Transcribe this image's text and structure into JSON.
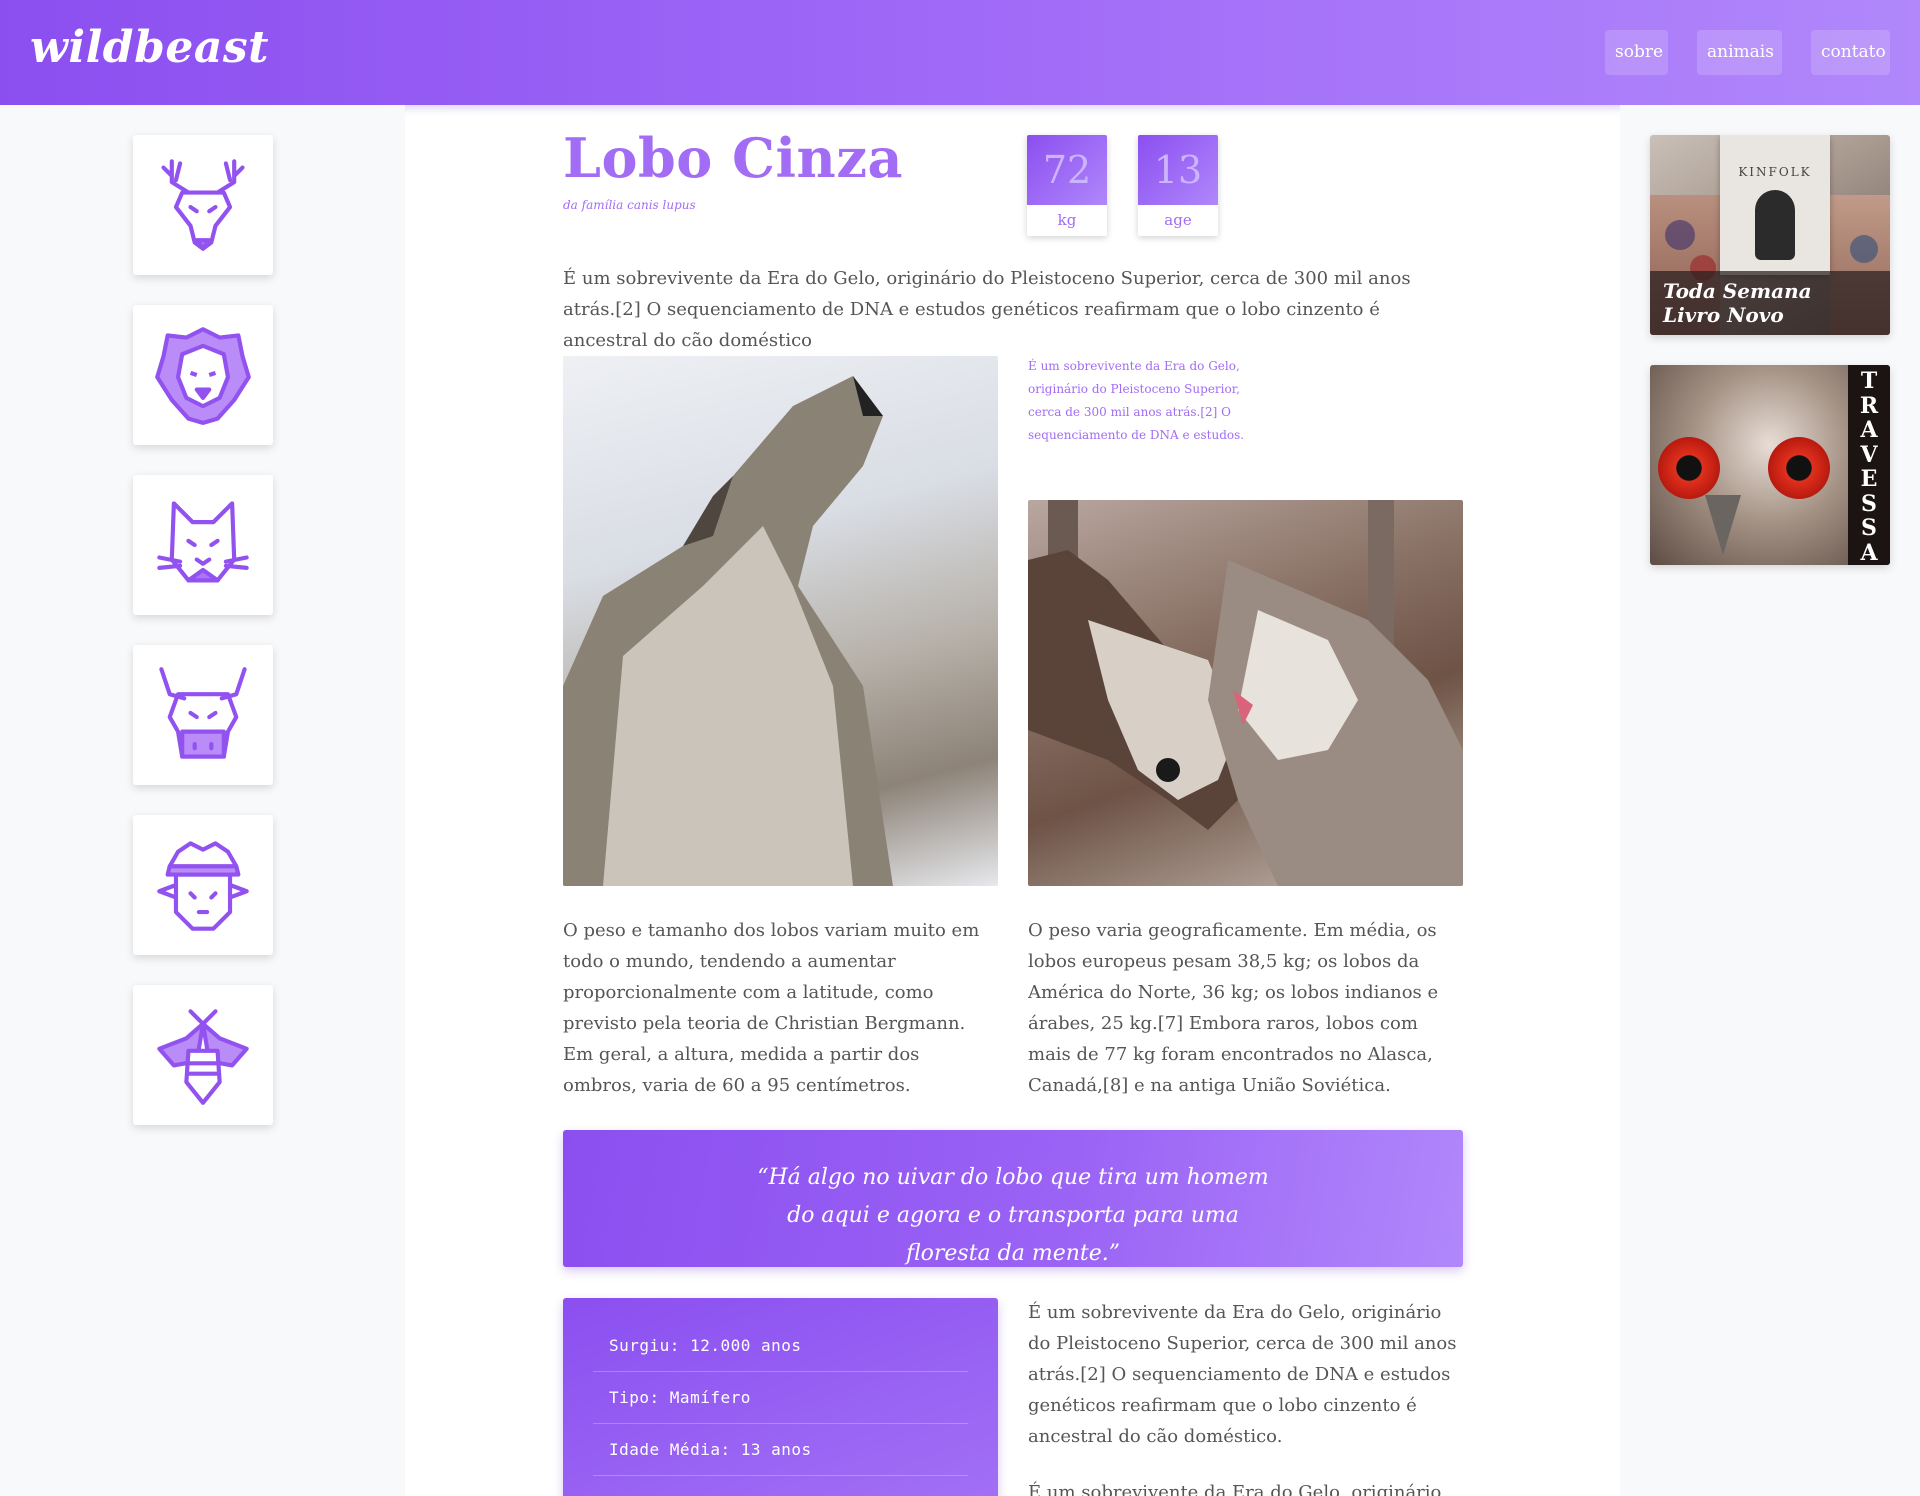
{
  "header": {
    "logo": "wildbeast",
    "nav": [
      {
        "label": "sobre"
      },
      {
        "label": "animais"
      },
      {
        "label": "contato"
      }
    ],
    "brand_color": "#8b4ff0"
  },
  "sidebar": {
    "icons": [
      {
        "name": "deer-icon"
      },
      {
        "name": "lion-icon"
      },
      {
        "name": "cat-icon"
      },
      {
        "name": "bull-icon"
      },
      {
        "name": "sheep-icon"
      },
      {
        "name": "bee-icon"
      }
    ]
  },
  "article": {
    "title": "Lobo Cinza",
    "subtitle": "da família canis lupus",
    "stats": [
      {
        "value": "72",
        "label": "kg"
      },
      {
        "value": "13",
        "label": "age"
      }
    ],
    "intro": "É um sobrevivente da Era do Gelo, originário do Pleistoceno Superior, cerca de 300 mil anos atrás.[2] O sequenciamento de DNA e estudos genéticos reafirmam que o lobo cinzento é ancestral do cão doméstico",
    "side_note": "É um sobrevivente da Era do Gelo, originário do Pleistoceno Superior, cerca de 300 mil anos atrás.[2] O sequenciamento de DNA e estudos.",
    "col1": "O peso e tamanho dos lobos variam muito em todo o mundo, tendendo a aumentar proporcionalmente com a latitude, como previsto pela teoria de Christian Bergmann. Em geral, a altura, medida a partir dos ombros, varia de 60 a 95 centímetros.",
    "col2": "O peso varia geograficamente. Em média, os lobos europeus pesam 38,5 kg; os lobos da América do Norte, 36 kg; os lobos indianos e árabes, 25 kg.[7] Embora raros, lobos com mais de 77 kg foram encontrados no Alasca, Canadá,[8] e na antiga União Soviética.",
    "quote": "“Há algo no uivar do lobo que tira um homem do aqui e agora e o transporta para uma floresta da mente.”",
    "facts": [
      "Surgiu: 12.000 anos",
      "Tipo: Mamífero",
      "Idade Média: 13 anos"
    ],
    "col3": "É um sobrevivente da Era do Gelo, originário do Pleistoceno Superior, cerca de 300 mil anos atrás.[2] O sequenciamento de DNA e estudos genéticos reafirmam que o lobo cinzento é ancestral do cão doméstico.",
    "col4": "É um sobrevivente da Era do Gelo, originário do"
  },
  "ads": {
    "ad1": {
      "book_title": "KINFOLK",
      "caption_line1": "Toda Semana",
      "caption_line2": "Livro Novo"
    },
    "ad2": {
      "letters": [
        "T",
        "R",
        "A",
        "V",
        "E",
        "S",
        "S",
        "A"
      ]
    }
  }
}
